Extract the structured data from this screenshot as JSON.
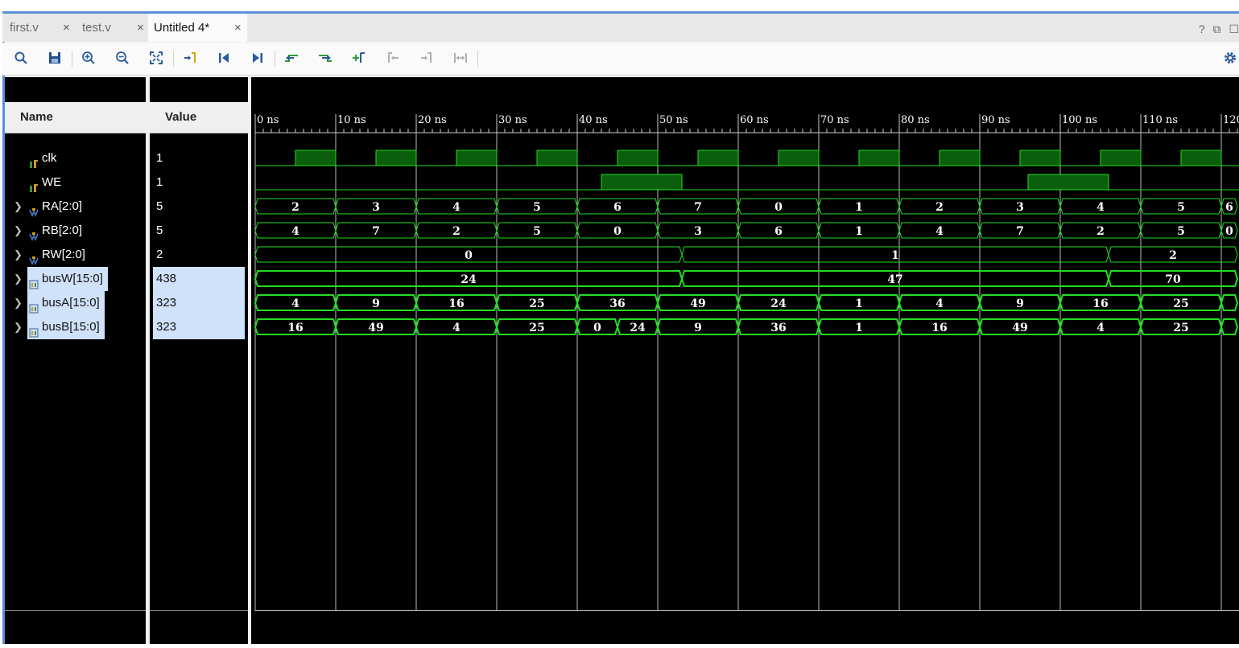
{
  "tabs": [
    {
      "label": "first.v",
      "active": false
    },
    {
      "label": "test.v",
      "active": false
    },
    {
      "label": "Untitled 4*",
      "active": true
    }
  ],
  "tab_tools": {
    "help": "?",
    "restore": "⧉",
    "maximize": "☐"
  },
  "toolbar": {
    "buttons": [
      "search-icon",
      "save-icon",
      "zoom-in-icon",
      "zoom-out-icon",
      "zoom-fit-icon",
      "go-to-cursor-icon",
      "go-to-time-zero-icon",
      "go-to-last-time-icon",
      "previous-transition-icon",
      "next-transition-icon",
      "add-marker-icon",
      "previous-marker-icon",
      "next-marker-icon",
      "swap-cursors-icon"
    ],
    "settings_icon": "gear-icon"
  },
  "columns": {
    "name": "Name",
    "value": "Value"
  },
  "colors": {
    "wave": "#22dd22",
    "wave_fill": "#0b5e0b",
    "selection": "#cfe2fa",
    "tab_accent": "#5a8fd6"
  },
  "timeline": {
    "unit": "ns",
    "ticks": [
      "0 ns",
      "10 ns",
      "20 ns",
      "30 ns",
      "40 ns",
      "50 ns",
      "60 ns",
      "70 ns",
      "80 ns",
      "90 ns",
      "100 ns",
      "110 ns",
      "120"
    ]
  },
  "signals": [
    {
      "name": "clk",
      "value": "1",
      "kind": "bit",
      "expandable": false,
      "selected": false,
      "high": [
        [
          5,
          10
        ],
        [
          15,
          20
        ],
        [
          25,
          30
        ],
        [
          35,
          40
        ],
        [
          45,
          50
        ],
        [
          55,
          60
        ],
        [
          65,
          70
        ],
        [
          75,
          80
        ],
        [
          85,
          90
        ],
        [
          95,
          100
        ],
        [
          105,
          110
        ],
        [
          115,
          120
        ]
      ]
    },
    {
      "name": "WE",
      "value": "1",
      "kind": "bit",
      "expandable": false,
      "selected": false,
      "high": [
        [
          43,
          53
        ],
        [
          96,
          106
        ]
      ]
    },
    {
      "name": "RA[2:0]",
      "value": "5",
      "kind": "bus",
      "expandable": true,
      "selected": false,
      "segments": [
        [
          0,
          10,
          "2"
        ],
        [
          10,
          20,
          "3"
        ],
        [
          20,
          30,
          "4"
        ],
        [
          30,
          40,
          "5"
        ],
        [
          40,
          50,
          "6"
        ],
        [
          50,
          60,
          "7"
        ],
        [
          60,
          70,
          "0"
        ],
        [
          70,
          80,
          "1"
        ],
        [
          80,
          90,
          "2"
        ],
        [
          90,
          100,
          "3"
        ],
        [
          100,
          110,
          "4"
        ],
        [
          110,
          120,
          "5"
        ],
        [
          120,
          122,
          "6"
        ]
      ]
    },
    {
      "name": "RB[2:0]",
      "value": "5",
      "kind": "bus",
      "expandable": true,
      "selected": false,
      "segments": [
        [
          0,
          10,
          "4"
        ],
        [
          10,
          20,
          "7"
        ],
        [
          20,
          30,
          "2"
        ],
        [
          30,
          40,
          "5"
        ],
        [
          40,
          50,
          "0"
        ],
        [
          50,
          60,
          "3"
        ],
        [
          60,
          70,
          "6"
        ],
        [
          70,
          80,
          "1"
        ],
        [
          80,
          90,
          "4"
        ],
        [
          90,
          100,
          "7"
        ],
        [
          100,
          110,
          "2"
        ],
        [
          110,
          120,
          "5"
        ],
        [
          120,
          122,
          "0"
        ]
      ]
    },
    {
      "name": "RW[2:0]",
      "value": "2",
      "kind": "bus",
      "expandable": true,
      "selected": false,
      "segments": [
        [
          0,
          53,
          "0"
        ],
        [
          53,
          106,
          "1"
        ],
        [
          106,
          122,
          "2"
        ]
      ]
    },
    {
      "name": "busW[15:0]",
      "value": "438",
      "kind": "bus",
      "expandable": true,
      "selected": true,
      "segments": [
        [
          0,
          53,
          "24"
        ],
        [
          53,
          106,
          "47"
        ],
        [
          106,
          122,
          "70"
        ]
      ]
    },
    {
      "name": "busA[15:0]",
      "value": "323",
      "kind": "bus",
      "expandable": true,
      "selected": true,
      "segments": [
        [
          0,
          10,
          "4"
        ],
        [
          10,
          20,
          "9"
        ],
        [
          20,
          30,
          "16"
        ],
        [
          30,
          40,
          "25"
        ],
        [
          40,
          50,
          "36"
        ],
        [
          50,
          60,
          "49"
        ],
        [
          60,
          70,
          "24"
        ],
        [
          70,
          80,
          "1"
        ],
        [
          80,
          90,
          "4"
        ],
        [
          90,
          100,
          "9"
        ],
        [
          100,
          110,
          "16"
        ],
        [
          110,
          120,
          "25"
        ],
        [
          120,
          122,
          ""
        ]
      ]
    },
    {
      "name": "busB[15:0]",
      "value": "323",
      "kind": "bus",
      "expandable": true,
      "selected": true,
      "segments": [
        [
          0,
          10,
          "16"
        ],
        [
          10,
          20,
          "49"
        ],
        [
          20,
          30,
          "4"
        ],
        [
          30,
          40,
          "25"
        ],
        [
          40,
          45,
          "0"
        ],
        [
          45,
          50,
          "24"
        ],
        [
          50,
          60,
          "9"
        ],
        [
          60,
          70,
          "36"
        ],
        [
          70,
          80,
          "1"
        ],
        [
          80,
          90,
          "16"
        ],
        [
          90,
          100,
          "49"
        ],
        [
          100,
          110,
          "4"
        ],
        [
          110,
          120,
          "25"
        ],
        [
          120,
          122,
          ""
        ]
      ]
    }
  ]
}
